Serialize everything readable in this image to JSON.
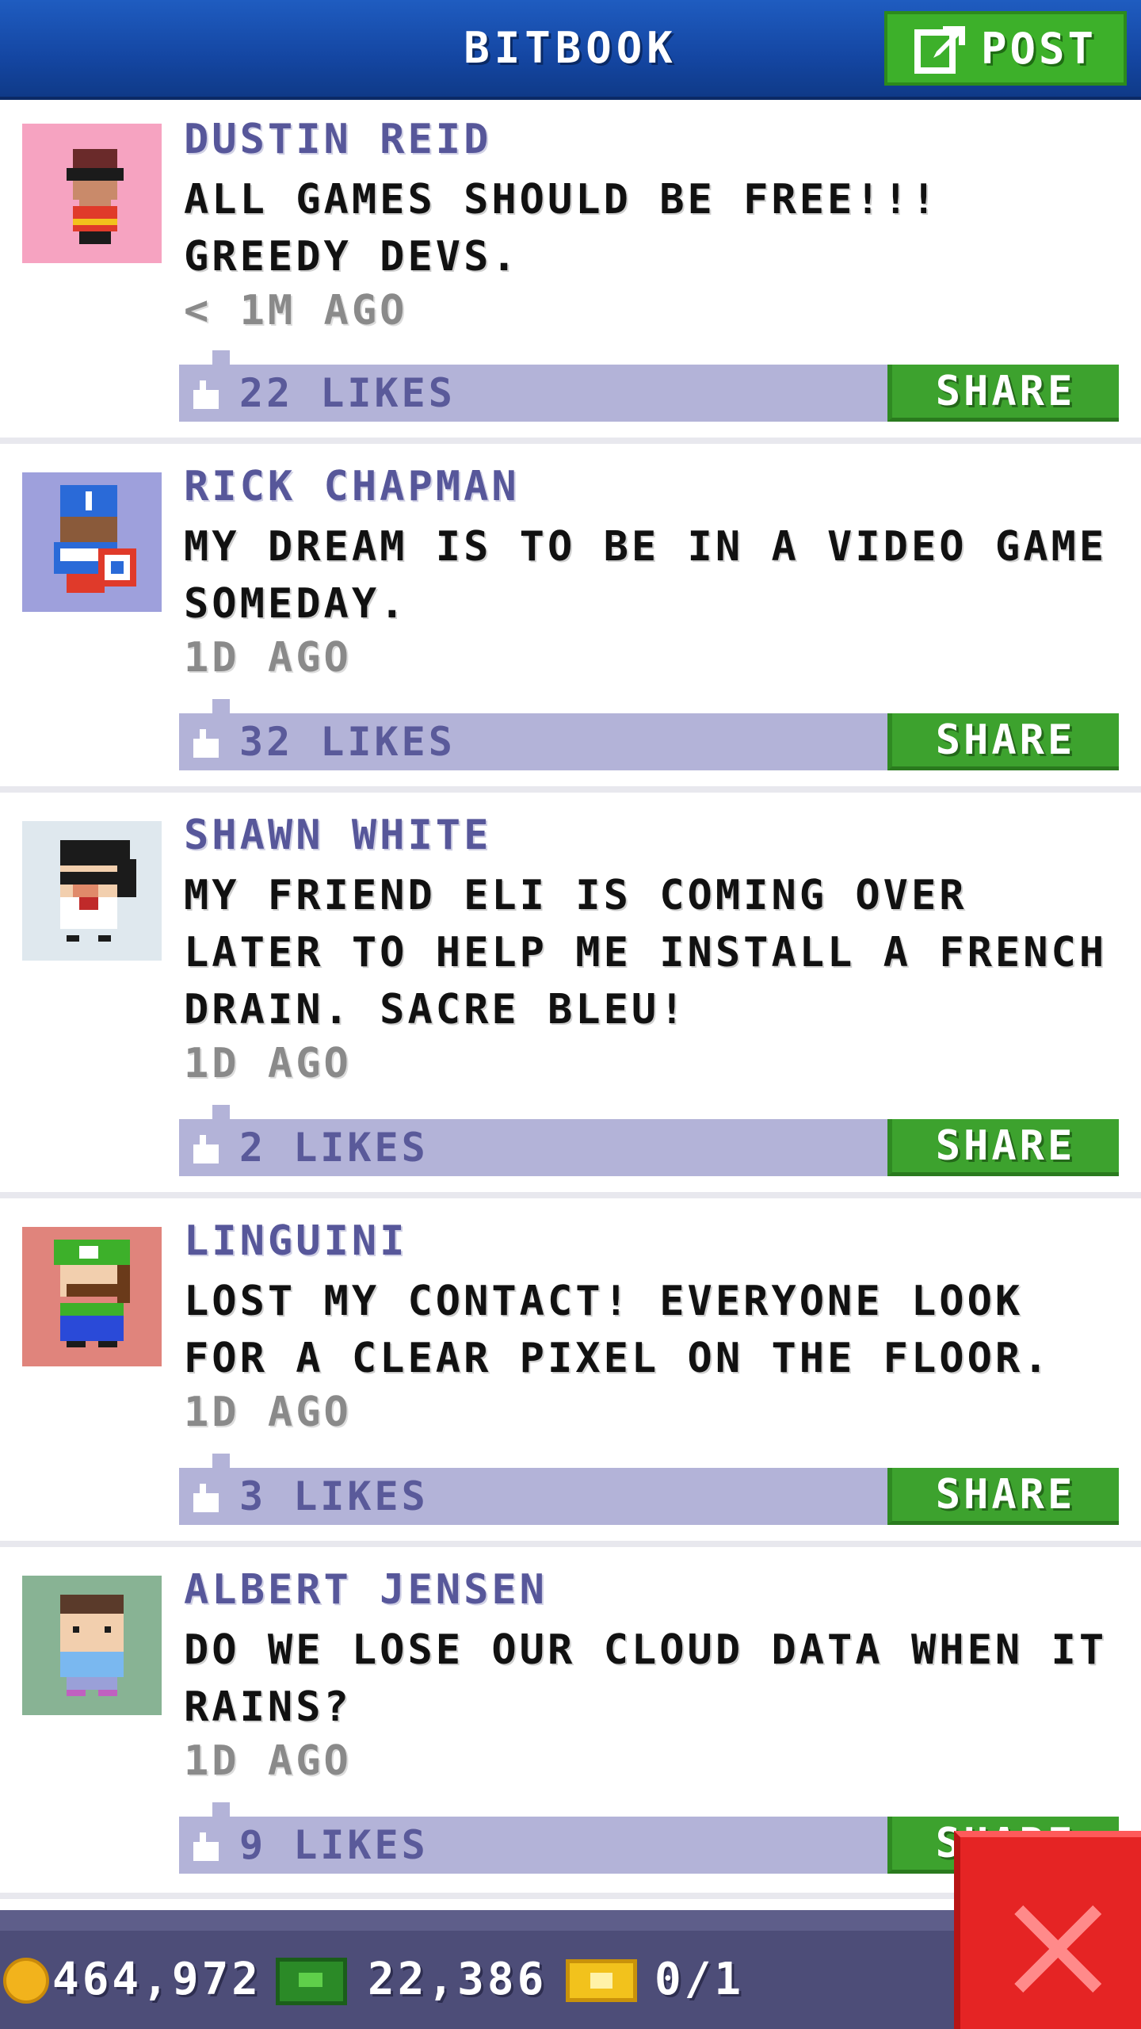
{
  "header": {
    "title": "BITBOOK",
    "post_label": "POST"
  },
  "colors": {
    "header_blue": "#1446a2",
    "share_green": "#3da22e",
    "like_bar": "#b3b3d8",
    "author_purple": "#57579a",
    "close_red": "#e52424"
  },
  "posts": [
    {
      "author": "DUSTIN REID",
      "message": "ALL GAMES SHOULD BE FREE!!! GREEDY DEVS.",
      "time": "< 1M AGO",
      "likes": "22 LIKES",
      "share": "SHARE",
      "avatar_bg": "#f6a3c1",
      "avatar_icon": "bitizen-bandit-icon"
    },
    {
      "author": "RICK CHAPMAN",
      "message": "MY DREAM IS TO BE IN A VIDEO GAME SOMEDAY.",
      "time": "1D AGO",
      "likes": "32 LIKES",
      "share": "SHARE",
      "avatar_bg": "#9ea0dc",
      "avatar_icon": "bitizen-captain-icon"
    },
    {
      "author": "SHAWN WHITE",
      "message": "MY FRIEND ELI IS COMING OVER LATER TO HELP ME INSTALL A FRENCH DRAIN. SACRE BLEU!",
      "time": "1D AGO",
      "likes": "2 LIKES",
      "share": "SHARE",
      "avatar_bg": "#dfe8ee",
      "avatar_icon": "bitizen-sunglasses-icon"
    },
    {
      "author": "LINGUINI",
      "message": "LOST MY CONTACT! EVERYONE LOOK FOR A CLEAR PIXEL ON THE FLOOR.",
      "time": "1D AGO",
      "likes": "3 LIKES",
      "share": "SHARE",
      "avatar_bg": "#e0847c",
      "avatar_icon": "bitizen-plumber-icon"
    },
    {
      "author": "ALBERT JENSEN",
      "message": "DO WE LOSE OUR CLOUD DATA WHEN IT RAINS?",
      "time": "1D AGO",
      "likes": "9 LIKES",
      "share": "SHARE",
      "avatar_bg": "#88b394",
      "avatar_icon": "bitizen-casual-icon"
    }
  ],
  "footer": {
    "coins": "464,972",
    "bux": "22,386",
    "tickets": "0/1"
  }
}
